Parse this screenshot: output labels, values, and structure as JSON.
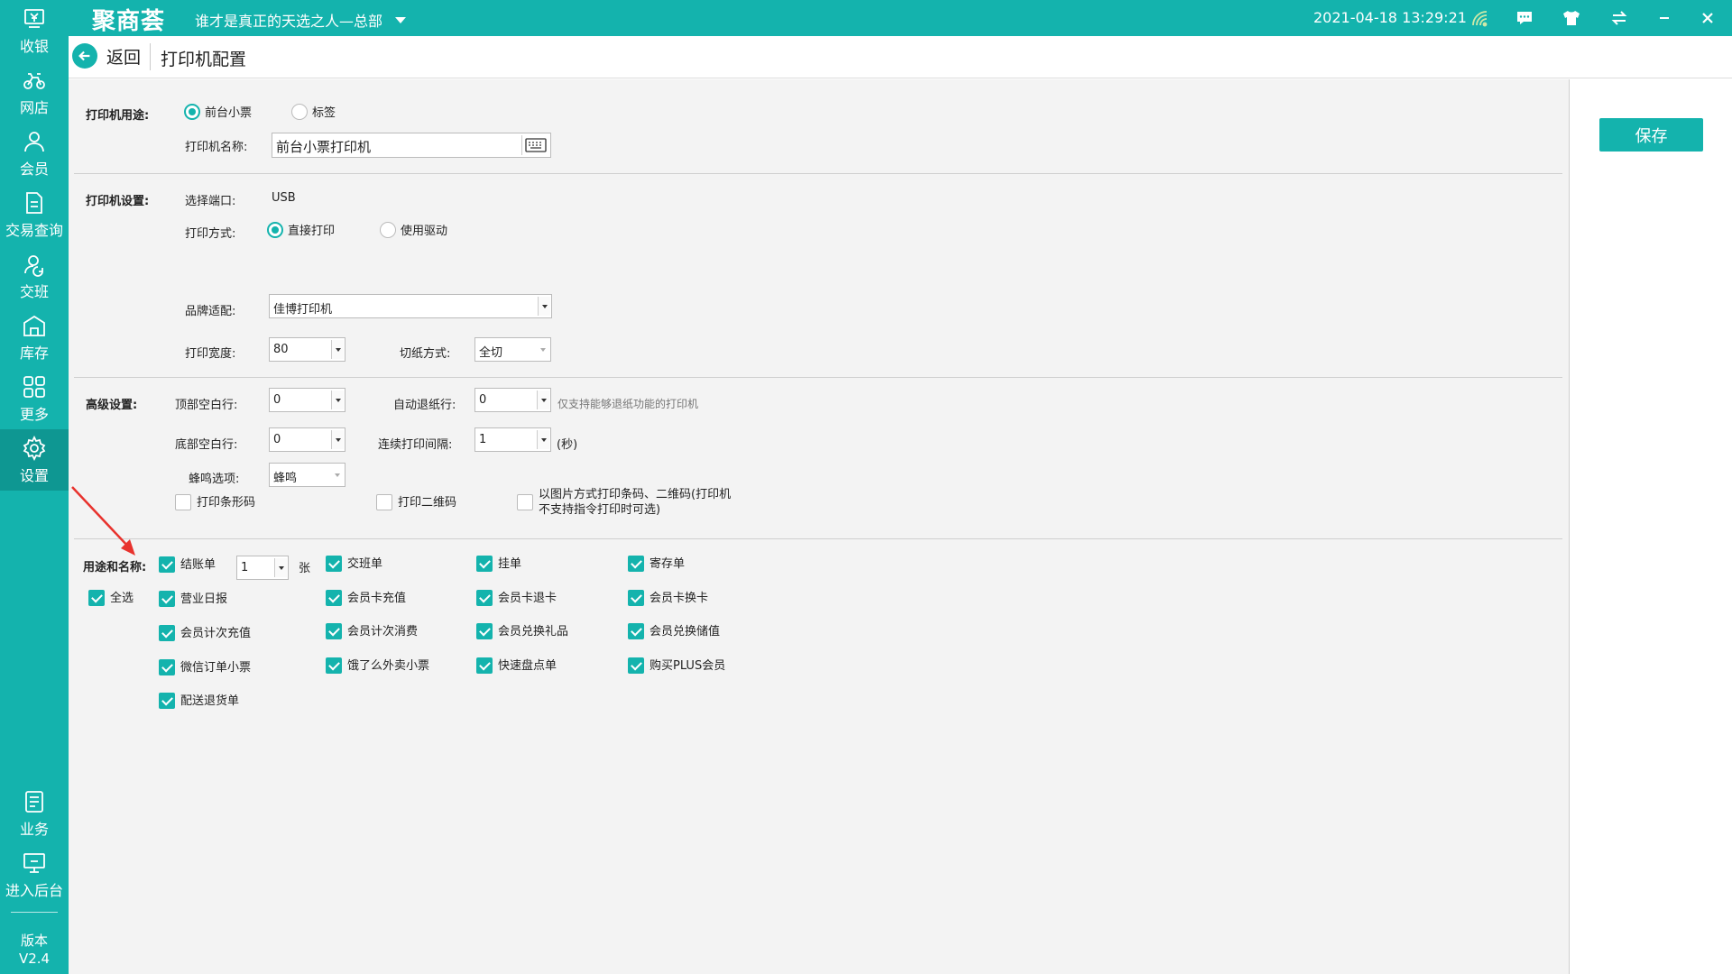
{
  "sidebar": {
    "items": [
      {
        "label": "收银",
        "icon": "cashier-icon"
      },
      {
        "label": "网店",
        "icon": "bike-icon"
      },
      {
        "label": "会员",
        "icon": "user-icon"
      },
      {
        "label": "交易查询",
        "icon": "document-icon"
      },
      {
        "label": "交班",
        "icon": "shift-icon"
      },
      {
        "label": "库存",
        "icon": "warehouse-icon"
      },
      {
        "label": "更多",
        "icon": "grid-icon"
      },
      {
        "label": "设置",
        "icon": "gear-icon"
      },
      {
        "label": "业务",
        "icon": "business-icon"
      },
      {
        "label": "进入后台",
        "icon": "monitor-icon"
      }
    ],
    "version_label": "版本",
    "version_value": "V2.4"
  },
  "topbar": {
    "logo": "聚商荟",
    "store": "谁才是真正的天选之人—总部",
    "datetime": "2021-04-18 13:29:21"
  },
  "breadcrumb": {
    "back": "返回",
    "title": "打印机配置"
  },
  "save_label": "保存",
  "usage": {
    "label": "打印机用途:",
    "option_receipt": "前台小票",
    "option_tag": "标签",
    "name_label": "打印机名称:",
    "name_value": "前台小票打印机"
  },
  "settings": {
    "label": "打印机设置:",
    "port_label": "选择端口:",
    "port_value": "USB",
    "mode_label": "打印方式:",
    "mode_direct": "直接打印",
    "mode_driver": "使用驱动",
    "brand_label": "品牌适配:",
    "brand_value": "佳博打印机",
    "width_label": "打印宽度:",
    "width_value": "80",
    "cut_label": "切纸方式:",
    "cut_value": "全切"
  },
  "advanced": {
    "label": "高级设置:",
    "top_blank_label": "顶部空白行:",
    "top_blank_value": "0",
    "auto_retract_label": "自动退纸行:",
    "auto_retract_value": "0",
    "auto_retract_hint": "仅支持能够退纸功能的打印机",
    "bottom_blank_label": "底部空白行:",
    "bottom_blank_value": "0",
    "interval_label": "连续打印间隔:",
    "interval_value": "1",
    "interval_unit": "(秒)",
    "beep_label": "蜂鸣选项:",
    "beep_value": "蜂鸣",
    "print_barcode": "打印条形码",
    "print_qrcode": "打印二维码",
    "image_mode": "以图片方式打印条码、二维码(打印机不支持指令打印时可选)"
  },
  "purpose": {
    "label": "用途和名称:",
    "select_all": "全选",
    "copies_value": "1",
    "copies_unit": "张",
    "items": {
      "checkout": "结账单",
      "shift": "交班单",
      "hold": "挂单",
      "deposit": "寄存单",
      "daily": "营业日报",
      "card_recharge": "会员卡充值",
      "card_refund": "会员卡退卡",
      "card_exchange": "会员卡换卡",
      "count_recharge": "会员计次充值",
      "count_consume": "会员计次消费",
      "gift_redeem": "会员兑换礼品",
      "redeem_value": "会员兑换储值",
      "wechat_order": "微信订单小票",
      "eleme_order": "饿了么外卖小票",
      "quick_stock": "快速盘点单",
      "plus_member": "购买PLUS会员",
      "delivery_return": "配送退货单"
    }
  },
  "colors": {
    "brand": "#14b3ad",
    "annotation_arrow": "#e8322d"
  }
}
